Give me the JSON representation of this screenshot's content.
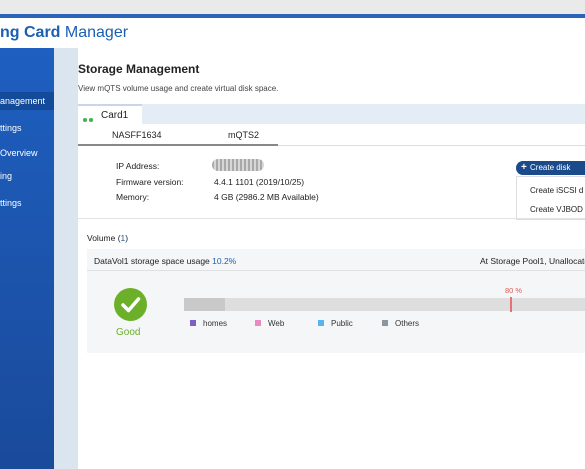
{
  "app": {
    "title_bold": "ng Card",
    "title_rest": " Manager"
  },
  "sidebar": {
    "items": [
      {
        "label": "anagement",
        "active": true
      },
      {
        "label": "ttings",
        "active": false
      },
      {
        "label": "Overview",
        "active": false
      },
      {
        "label": "ing",
        "active": false
      },
      {
        "label": "ttings",
        "active": false
      }
    ]
  },
  "page": {
    "title": "Storage Management",
    "subtitle": "View mQTS volume usage and create virtual disk space."
  },
  "card": {
    "tab_label": "Card1",
    "status_color": "#3bb54a"
  },
  "subtabs": {
    "items": [
      "NASFF1634",
      "mQTS2"
    ],
    "active_index": 0
  },
  "info": {
    "ip_label": "IP Address:",
    "ip_value": "",
    "firmware_label": "Firmware version:",
    "firmware_value": "4.4.1 1101 (2019/10/25)",
    "memory_label": "Memory:",
    "memory_value": "4 GB (2986.2 MB Available)"
  },
  "actions": {
    "create_label": "Create disk",
    "create_icon": "plus-icon",
    "menu": [
      "Create iSCSI d",
      "Create VJBOD"
    ]
  },
  "volume": {
    "label": "Volume (",
    "count": "1",
    "close": ")",
    "name_text": "DataVol1 storage space usage ",
    "usage_pct": "10.2%",
    "usage_fraction": 0.102,
    "pool_info": "At Storage Pool1, Unallocate",
    "status_label": "Good",
    "status_icon": "check-circle-icon",
    "status_color": "#6cb02a",
    "threshold_label": "80 %",
    "legend": [
      {
        "label": "homes",
        "color": "#7e5fc4"
      },
      {
        "label": "Web",
        "color": "#e98bc0"
      },
      {
        "label": "Public",
        "color": "#58b4ee"
      },
      {
        "label": "Others",
        "color": "#8d969e"
      }
    ]
  }
}
